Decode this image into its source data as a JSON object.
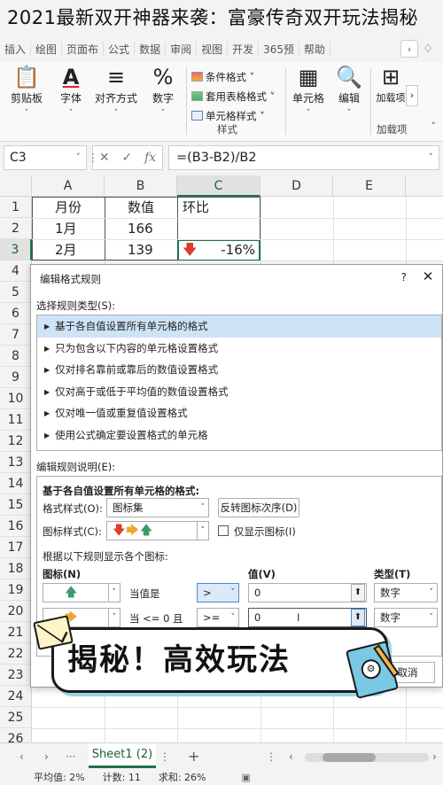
{
  "article_title": "2021最新双开神器来袭：富豪传奇双开玩法揭秘",
  "ribbon": {
    "tabs": [
      "插入",
      "绘图",
      "页面布",
      "公式",
      "数据",
      "审阅",
      "视图",
      "开发",
      "365预",
      "帮助"
    ],
    "more_label": "›",
    "buttons": {
      "clipboard": "剪贴板",
      "font": "字体",
      "alignment": "对齐方式",
      "number": "数字",
      "cells": "单元格",
      "edit": "编辑",
      "addins": "加载项"
    },
    "styles": {
      "conditional_format": "条件格式 ˅",
      "table_format": "套用表格格式 ˅",
      "cell_styles": "单元格样式 ˅",
      "group_label": "样式"
    },
    "addin_group_label": "加载项",
    "scroll_label": "›"
  },
  "formula_bar": {
    "name_box": "C3",
    "formula": "=(B3-B2)/B2"
  },
  "sheet": {
    "columns": [
      "A",
      "B",
      "C",
      "D",
      "E"
    ],
    "rows": [
      "1",
      "2",
      "3",
      "4",
      "5",
      "6",
      "7",
      "8",
      "9",
      "10",
      "11",
      "12",
      "13",
      "14",
      "15",
      "16",
      "17",
      "18",
      "19",
      "20",
      "21",
      "22",
      "23",
      "24",
      "25",
      "26"
    ],
    "cells": {
      "A1": "月份",
      "B1": "数值",
      "C1": "环比",
      "A2": "1月",
      "B2": "166",
      "A3": "2月",
      "B3": "139",
      "C3": "-16%"
    }
  },
  "dialog": {
    "title": "编辑格式规则",
    "help": "?",
    "close": "✕",
    "select_type_label": "选择规则类型(S):",
    "rule_types": [
      "基于各自值设置所有单元格的格式",
      "只为包含以下内容的单元格设置格式",
      "仅对排名靠前或靠后的数值设置格式",
      "仅对高于或低于平均值的数值设置格式",
      "仅对唯一值或重复值设置格式",
      "使用公式确定要设置格式的单元格"
    ],
    "edit_desc_label": "编辑规则说明(E):",
    "desc_title": "基于各自值设置所有单元格的格式:",
    "format_style_label": "格式样式(O):",
    "format_style_value": "图标集",
    "reverse_button": "反转图标次序(D)",
    "icon_style_label": "图标样式(C):",
    "show_icon_only": "仅显示图标(I)",
    "rules_hint": "根据以下规则显示各个图标:",
    "col_icon": "图标(N)",
    "col_value": "值(V)",
    "col_type": "类型(T)",
    "rule1": {
      "cond": "当值是",
      "op": ">",
      "value": "0",
      "type": "数字"
    },
    "rule2": {
      "cond": "当 <= 0 且",
      "op": ">=",
      "value": "0",
      "type": "数字"
    },
    "cancel": "取消"
  },
  "banner": {
    "text": "揭秘！高效玩法"
  },
  "sheet_tabs": {
    "active": "Sheet1 (2)",
    "add": "+"
  },
  "status": {
    "average": "平均值: 2%",
    "count": "计数: 11",
    "sum": "求和: 26%"
  },
  "colors": {
    "accent": "#217346",
    "selection": "#cfe3f7",
    "red_arrow": "#d8402b",
    "yellow_arrow": "#eda82a",
    "green_arrow": "#3d9a6a"
  }
}
